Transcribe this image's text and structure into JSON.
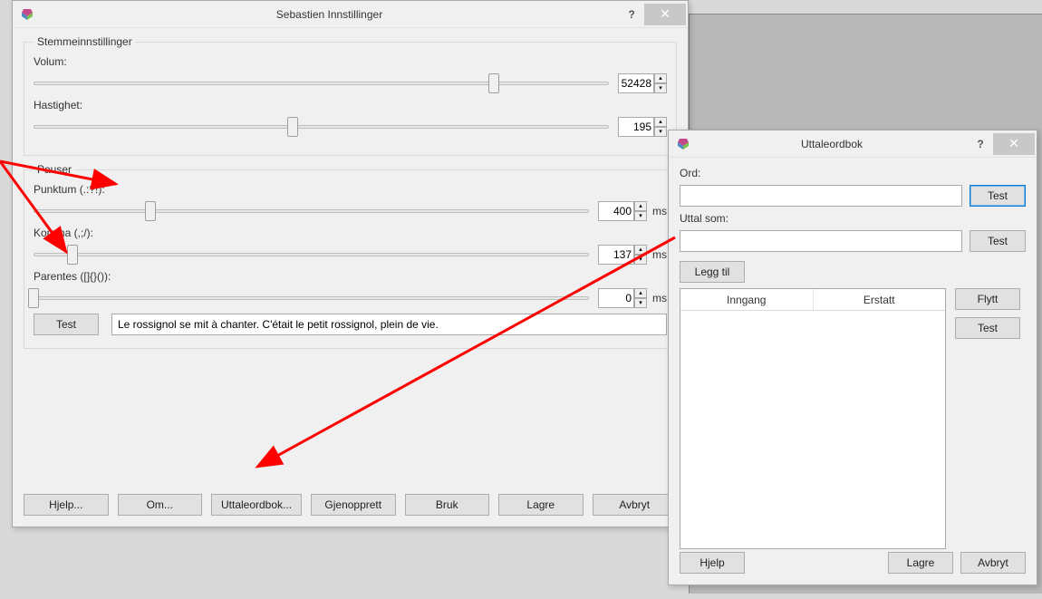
{
  "settings": {
    "title": "Sebastien Innstillinger",
    "voice_section": "Stemmeinnstillinger",
    "volume": {
      "label": "Volum:",
      "value": "52428",
      "thumb_pct": 80
    },
    "speed": {
      "label": "Hastighet:",
      "value": "195",
      "thumb_pct": 45
    },
    "pause_section": "Pauser",
    "period": {
      "label": "Punktum (.:?!):",
      "value": "400",
      "unit": "ms",
      "thumb_pct": 21
    },
    "comma": {
      "label": "Komma (,;/):",
      "value": "137",
      "unit": "ms",
      "thumb_pct": 7
    },
    "paren": {
      "label": "Parentes ([]{}()):",
      "value": "0",
      "unit": "ms",
      "thumb_pct": 0
    },
    "test_button": "Test",
    "test_text": "Le rossignol se mit à chanter. C'était le petit rossignol, plein de vie.",
    "buttons": {
      "help": "Hjelp...",
      "about": "Om...",
      "dict": "Uttaleordbok...",
      "restore": "Gjenopprett",
      "apply": "Bruk",
      "save": "Lagre",
      "cancel": "Avbryt"
    }
  },
  "dict": {
    "title": "Uttaleordbok",
    "word_label": "Ord:",
    "word_value": "",
    "pronounce_label": "Uttal som:",
    "pronounce_value": "",
    "test": "Test",
    "add": "Legg til",
    "col_in": "Inngang",
    "col_replace": "Erstatt",
    "move": "Flytt",
    "help": "Hjelp",
    "save": "Lagre",
    "cancel": "Avbryt"
  }
}
